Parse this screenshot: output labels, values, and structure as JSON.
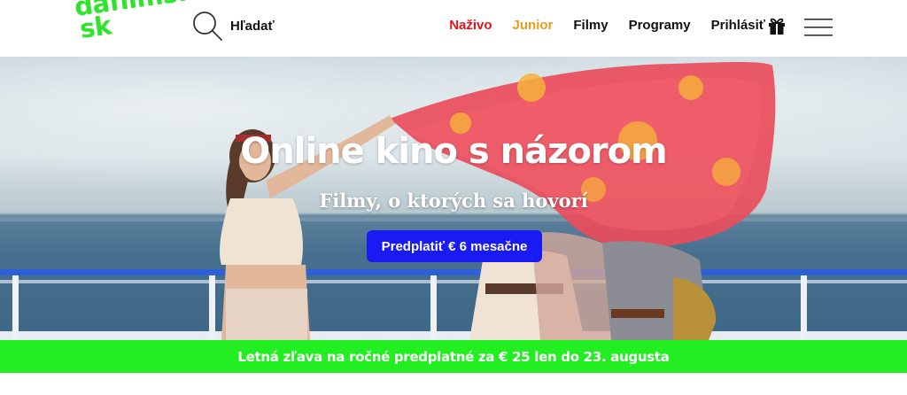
{
  "logo": {
    "line1": "dafilms.",
    "line2": "sk"
  },
  "search": {
    "label": "Hľadať",
    "icon": "search-icon"
  },
  "nav": [
    {
      "label": "Naživo",
      "color": "#e8141b"
    },
    {
      "label": "Junior",
      "color": "#ef9a17"
    },
    {
      "label": "Filmy",
      "color": "#111111"
    },
    {
      "label": "Programy",
      "color": "#111111"
    },
    {
      "label": "Prihlásiť",
      "color": "#111111"
    }
  ],
  "icons": {
    "gift": "gift-icon",
    "menu": "hamburger-menu-icon"
  },
  "hero": {
    "title": "Online kino s názorom",
    "subtitle": "Filmy, o ktorých sa hovorí",
    "cta_label": "Predplatiť € 6 mesačne"
  },
  "promo": {
    "text": "Letná zľava na ročné predplatné za € 25 len do 23. augusta"
  },
  "colors": {
    "brand_green": "#2fe52b",
    "cta_blue": "#1a1af2",
    "promo_green": "#22ee22"
  }
}
